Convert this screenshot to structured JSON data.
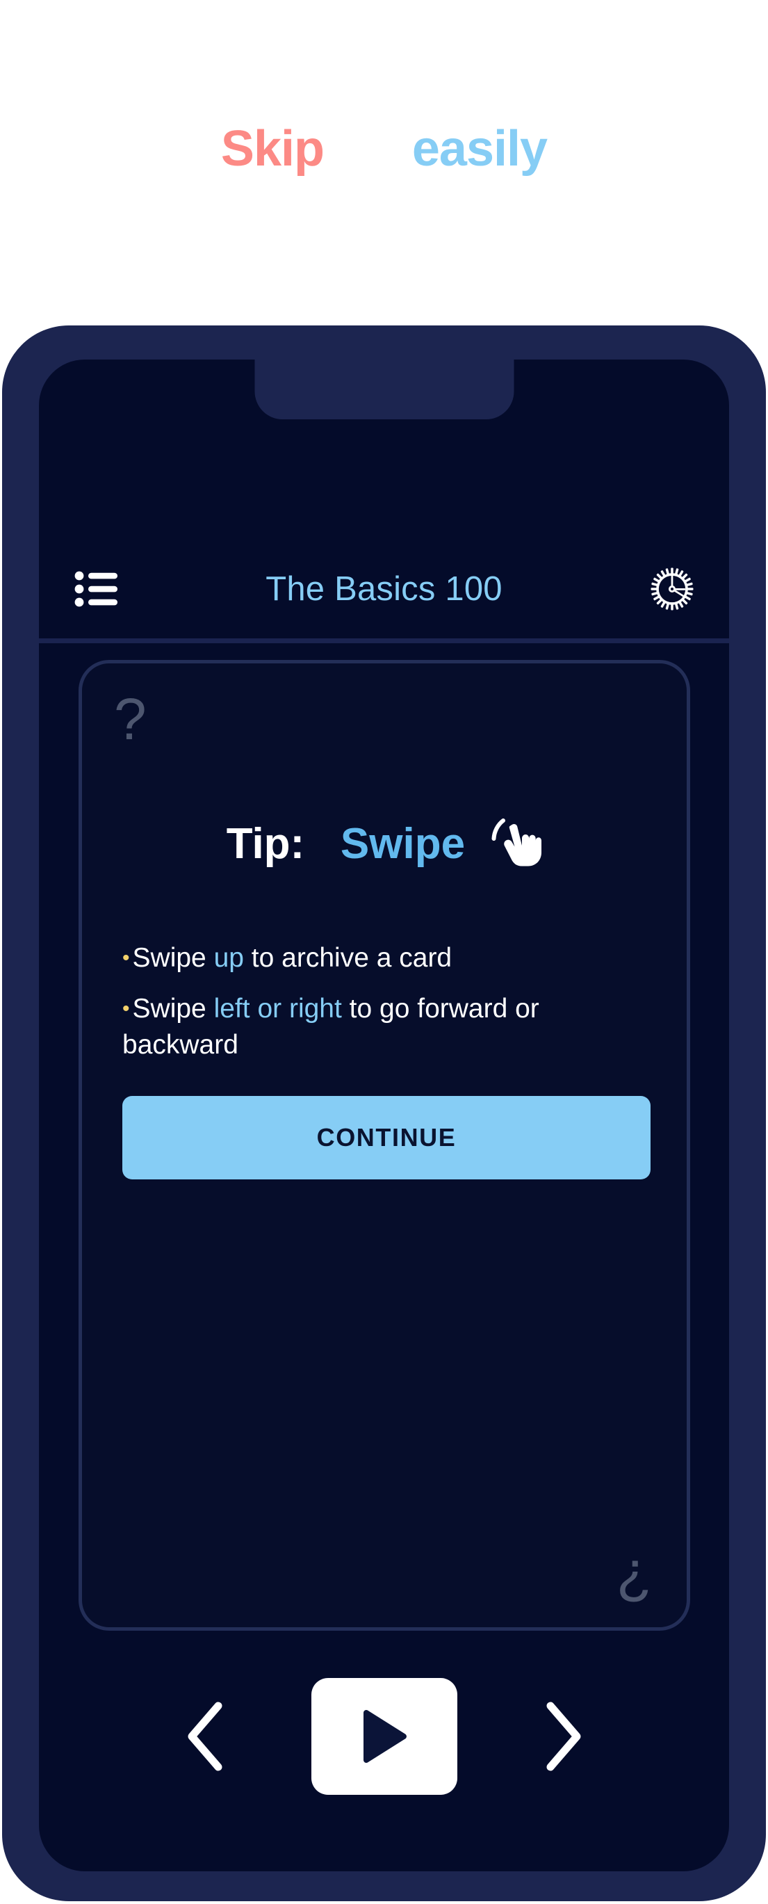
{
  "caption": {
    "word_left": "Skip",
    "word_right": "easily",
    "color_left": "#fc8a85",
    "color_right": "#86cdf5"
  },
  "phone": {
    "frame_color": "#1c2550",
    "screen_color": "#040b2a"
  },
  "app": {
    "header": {
      "menu_icon": "list-icon",
      "title": "The Basics 100",
      "title_color": "#86cdf5",
      "settings_icon": "gear-icon"
    },
    "card": {
      "border_color": "#232e58",
      "question_mark_top": "?",
      "question_mark_bottom": "¿",
      "question_mark_color": "#4d566f",
      "tip": {
        "label": "Tip:",
        "word": "Swipe",
        "hand_icon": "pointing-hand-icon"
      },
      "bullets": [
        {
          "marker": "•",
          "marker_color": "#f2d06b",
          "parts": [
            {
              "text": "Swipe ",
              "highlight": false
            },
            {
              "text": "up",
              "highlight": true
            },
            {
              "text": " to archive a card",
              "highlight": false
            }
          ]
        },
        {
          "marker": "•",
          "marker_color": "#f2d06b",
          "parts": [
            {
              "text": "Swipe ",
              "highlight": false
            },
            {
              "text": "left or right",
              "highlight": true
            },
            {
              "text": " to go forward or backward",
              "highlight": false
            }
          ]
        }
      ],
      "highlight_color": "#86cdf5",
      "continue_label": "CONTINUE",
      "continue_bg": "#86cdf5",
      "continue_text_color": "#0a1330"
    },
    "bottom_nav": {
      "prev_icon": "chevron-left-icon",
      "play_icon": "play-icon",
      "next_icon": "chevron-right-icon"
    }
  }
}
